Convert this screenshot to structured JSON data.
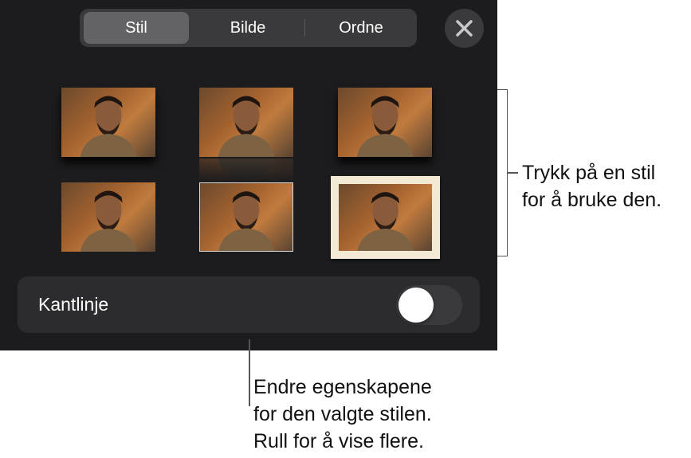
{
  "tabs": [
    {
      "label": "Stil",
      "active": true
    },
    {
      "label": "Bilde",
      "active": false
    },
    {
      "label": "Ordne",
      "active": false
    }
  ],
  "close_icon": "close-icon",
  "styles": [
    {
      "name": "shadow"
    },
    {
      "name": "reflection"
    },
    {
      "name": "drop-shadow"
    },
    {
      "name": "plain"
    },
    {
      "name": "thin-border"
    },
    {
      "name": "cream-frame"
    }
  ],
  "border_row": {
    "label": "Kantlinje",
    "toggle_on": false
  },
  "callouts": {
    "style_tip": [
      "Trykk på en stil",
      "for å bruke den."
    ],
    "properties_tip": [
      "Endre egenskapene",
      "for den valgte stilen.",
      "Rull for å vise flere."
    ]
  },
  "colors": {
    "panel": "#1c1c1e",
    "segment": "#3a3a3c",
    "segment_active": "#636366",
    "frame": "#f3ead6"
  }
}
